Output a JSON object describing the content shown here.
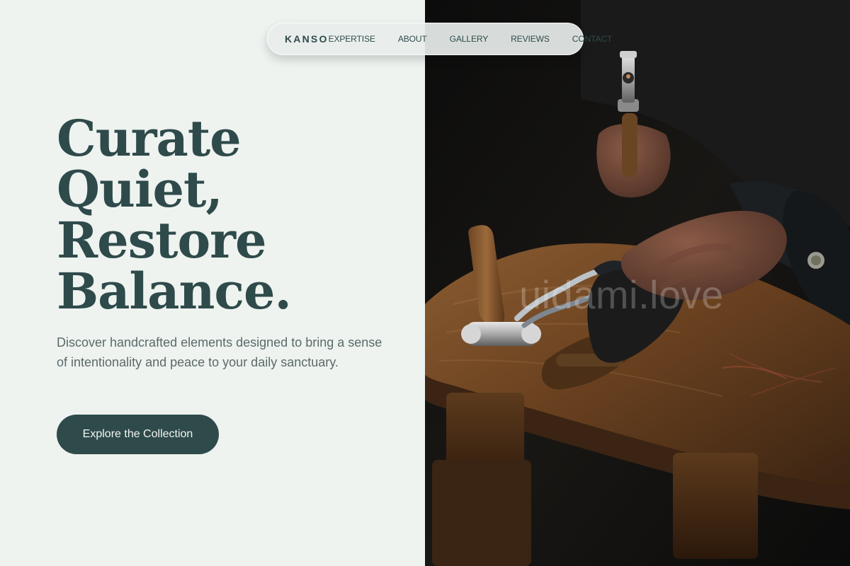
{
  "brand": {
    "name": "KANSO"
  },
  "nav": {
    "items": [
      {
        "label": "EXPERTISE"
      },
      {
        "label": "ABOUT"
      },
      {
        "label": "GALLERY"
      },
      {
        "label": "REVIEWS"
      },
      {
        "label": "CONTACT"
      }
    ]
  },
  "hero": {
    "title_lines": [
      "Curate",
      "Quiet,",
      "Restore",
      "Balance."
    ],
    "subtitle": "Discover handcrafted elements designed to bring a sense of intentionality and peace to your daily sanctuary.",
    "cta_label": "Explore the Collection"
  },
  "image": {
    "watermark_text": "uidami.love"
  },
  "colors": {
    "accent": "#2f4a4a",
    "background": "#eef3f0",
    "text_muted": "#5b6a69",
    "image_dark": "#121212"
  }
}
